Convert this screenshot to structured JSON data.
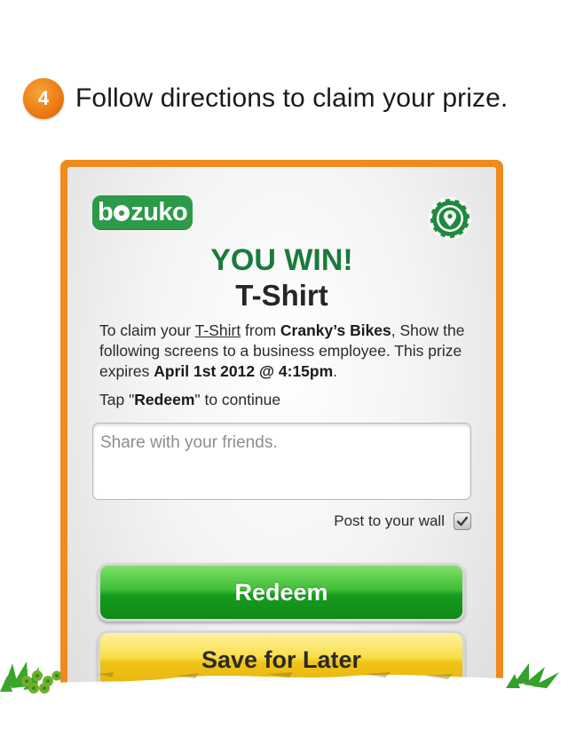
{
  "step": {
    "number": "4",
    "text": "Follow directions to claim your prize."
  },
  "header": {
    "logo": {
      "before": "b",
      "after": "zuko"
    },
    "chip_icon": "location-pin-icon"
  },
  "result": {
    "title": "YOU WIN!",
    "prize": "T-Shirt"
  },
  "description": {
    "p1": "To claim your ",
    "prize_link": "T-Shirt",
    "p2": " from ",
    "business": "Cranky’s Bikes",
    "p3": ", Show the following screens to a business employee. This prize expires ",
    "expires": "April 1st 2012 @ 4:15pm",
    "p4": "."
  },
  "tap": {
    "p1": "Tap \"",
    "keyword": "Redeem",
    "p2": "\" to continue"
  },
  "share": {
    "placeholder": "Share with your friends."
  },
  "post_wall": {
    "label": "Post to your wall",
    "checked": true
  },
  "buttons": {
    "redeem": "Redeem",
    "save_later": "Save for Later"
  },
  "colors": {
    "accent_orange": "#f08a1c",
    "win_green": "#1a7a3c",
    "brand_green": "#2c9a48"
  }
}
